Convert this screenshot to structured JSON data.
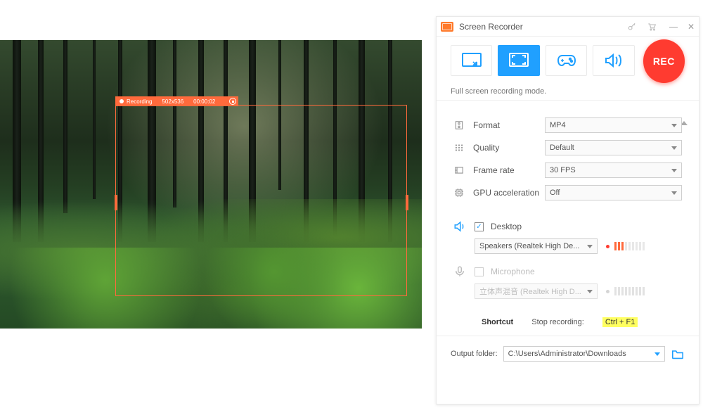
{
  "app_title": "Screen Recorder",
  "overlay": {
    "status": "Recording",
    "dimensions": "502x536",
    "elapsed": "00:00:02"
  },
  "rec_button": "REC",
  "mode_info": "Full screen recording mode.",
  "settings": {
    "format": {
      "label": "Format",
      "value": "MP4"
    },
    "quality": {
      "label": "Quality",
      "value": "Default"
    },
    "framerate": {
      "label": "Frame rate",
      "value": "30 FPS"
    },
    "gpu": {
      "label": "GPU acceleration",
      "value": "Off"
    }
  },
  "audio": {
    "desktop": {
      "label": "Desktop",
      "device": "Speakers (Realtek High De..."
    },
    "microphone": {
      "label": "Microphone",
      "device": "立体声混音 (Realtek High D..."
    }
  },
  "shortcut": {
    "label": "Shortcut",
    "action": "Stop recording:",
    "keys": "Ctrl + F1"
  },
  "output": {
    "label": "Output folder:",
    "path": "C:\\Users\\Administrator\\Downloads"
  }
}
